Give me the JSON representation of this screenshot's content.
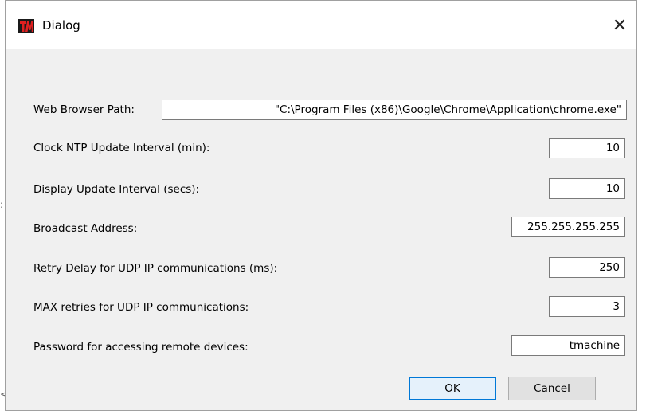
{
  "dialog": {
    "title": "Dialog",
    "close_glyph": "✕",
    "app_icon": "tm-logo-icon",
    "accent": "#0078d7"
  },
  "fields": [
    {
      "label": "Web Browser Path:",
      "value": "\"C:\\Program Files (x86)\\Google\\Chrome\\Application\\chrome.exe\""
    },
    {
      "label": "Clock NTP Update Interval (min):",
      "value": "10"
    },
    {
      "label": "Display Update Interval (secs):",
      "value": "10"
    },
    {
      "label": "Broadcast Address:",
      "value": "255.255.255.255"
    },
    {
      "label": "Retry Delay for UDP IP communications (ms):",
      "value": "250"
    },
    {
      "label": "MAX retries for UDP IP communications:",
      "value": "3"
    },
    {
      "label": "Password for accessing remote devices:",
      "value": "tmachine"
    }
  ],
  "buttons": {
    "ok": "OK",
    "cancel": "Cancel"
  }
}
